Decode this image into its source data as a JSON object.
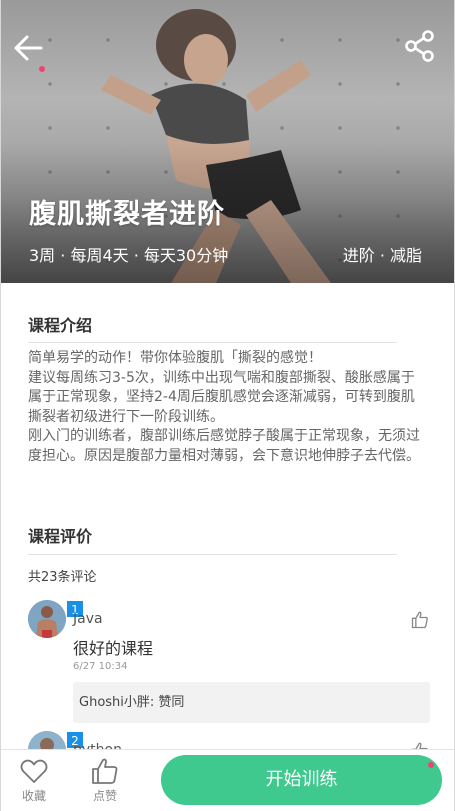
{
  "hero": {
    "title": "腹肌撕裂者进阶",
    "meta": "3周 · 每周4天 · 每天30分钟",
    "tags": "进阶 · 减脂"
  },
  "intro": {
    "title": "课程介绍",
    "paragraphs": [
      "简单易学的动作！带你体验腹肌「撕裂的感觉！",
      "建议每周练习3-5次，训练中出现气喘和腹部撕裂、酸胀感属于属于正常现象，坚持2-4周后腹肌感觉会逐渐减弱，可转到腹肌撕裂者初级进行下一阶段训练。",
      "刚入门的训练者，腹部训练后感觉脖子酸属于正常现象，无须过度担心。原因是腹部力量相对薄弱，会下意识地伸脖子去代偿。"
    ]
  },
  "reviews": {
    "title": "课程评价",
    "count_text": "共23条评论",
    "items": [
      {
        "rank": "1",
        "user": "Java",
        "text": "很好的课程",
        "time": "6/27 10:34",
        "reply": "Ghoshi小胖: 赞同"
      },
      {
        "rank": "2",
        "user": "python"
      }
    ]
  },
  "bottom_bar": {
    "favorite_label": "收藏",
    "like_label": "点赞",
    "start_label": "开始训练"
  },
  "colors": {
    "accent_green": "#3fc98e",
    "badge_blue": "#1a8fe6",
    "notice_pink": "#f0446d"
  },
  "icons": {
    "back": "arrow-left-icon",
    "share": "share-icon",
    "like": "thumbs-up-icon",
    "favorite": "heart-icon"
  }
}
